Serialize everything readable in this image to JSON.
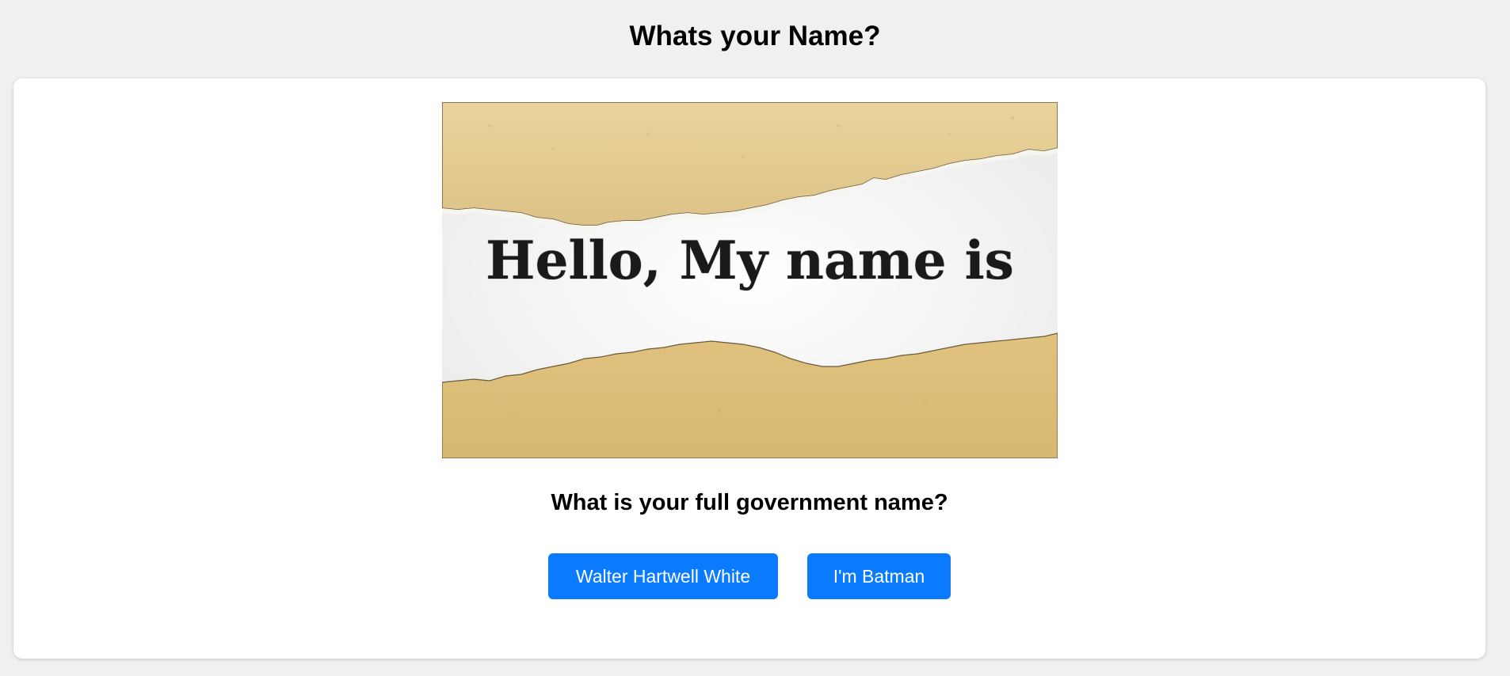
{
  "page": {
    "heading": "Whats your Name?"
  },
  "hero": {
    "image_text": "Hello, My name is",
    "colors": {
      "paper": "#e3c98f",
      "paper_dark": "#cfb271",
      "inner": "#fafafa"
    }
  },
  "question": {
    "text": "What is your full government name?"
  },
  "answers": [
    {
      "label": "Walter Hartwell White"
    },
    {
      "label": "I'm Batman"
    }
  ],
  "theme": {
    "button_color": "#0a7bff",
    "background": "#f0f0f0",
    "card": "#ffffff"
  }
}
